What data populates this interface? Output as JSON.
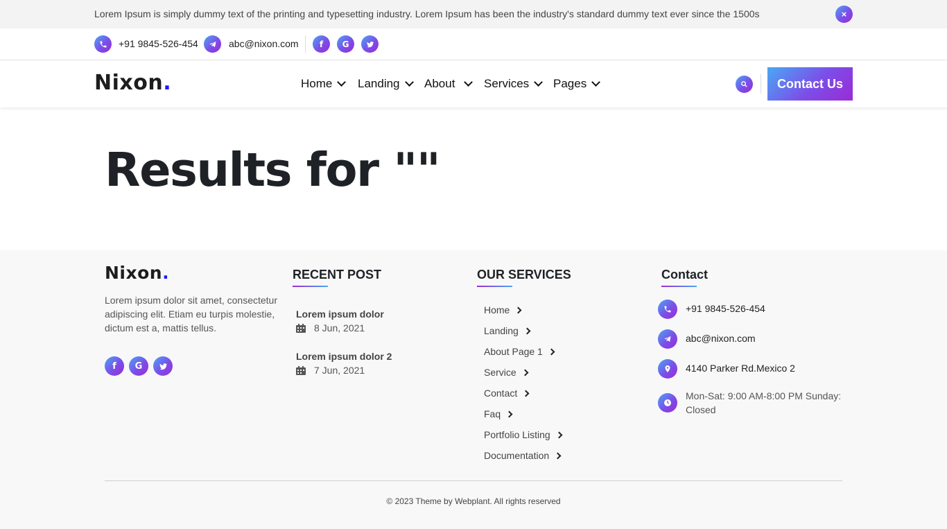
{
  "announcement": {
    "text": "Lorem Ipsum is simply dummy text of the printing and typesetting industry. Lorem Ipsum has been the industry's standard dummy text ever since the 1500s",
    "close_icon": "×"
  },
  "topbar": {
    "phone": "+91 9845-526-454",
    "email": "abc@nixon.com",
    "social": [
      {
        "icon": "facebook-icon",
        "glyph": "f"
      },
      {
        "icon": "google-icon",
        "glyph": "G"
      },
      {
        "icon": "twitter-icon",
        "glyph": "t"
      }
    ]
  },
  "header": {
    "logo": "Nixon",
    "logo_dot": ".",
    "nav": [
      {
        "label": "Home"
      },
      {
        "label": "Landing"
      },
      {
        "label": "About"
      },
      {
        "label": "Services"
      },
      {
        "label": "Pages"
      }
    ],
    "contact_button": "Contact Us"
  },
  "main": {
    "results_title": "Results for \"\""
  },
  "footer": {
    "logo": "Nixon",
    "logo_dot": ".",
    "about": "Lorem ipsum dolor sit amet, consectetur adipiscing elit. Etiam eu turpis molestie, dictum est a, mattis tellus.",
    "social": [
      {
        "icon": "facebook-icon",
        "glyph": "f"
      },
      {
        "icon": "google-icon",
        "glyph": "G"
      },
      {
        "icon": "twitter-icon",
        "glyph": "t"
      }
    ],
    "recent_post": {
      "heading": "RECENT POST",
      "posts": [
        {
          "title": "Lorem ipsum dolor",
          "date": "8 Jun, 2021"
        },
        {
          "title": "Lorem ipsum dolor 2",
          "date": "7 Jun, 2021"
        }
      ]
    },
    "services": {
      "heading": "OUR SERVICES",
      "items": [
        "Home",
        "Landing",
        "About Page 1",
        "Service",
        "Contact",
        "Faq",
        "Portfolio Listing",
        "Documentation"
      ]
    },
    "contact": {
      "heading": "Contact",
      "phone": "+91 9845-526-454",
      "email": "abc@nixon.com",
      "address": "4140 Parker Rd.Mexico 2",
      "hours": "Mon-Sat: 9:00 AM-8:00 PM Sunday: Closed"
    },
    "copyright": "© 2023 Theme by Webplant. All rights reserved"
  },
  "colors": {
    "gradient_start": "#4aa8f5",
    "gradient_mid": "#7b4ee8",
    "gradient_end": "#9b2bd6",
    "logo_dot": "#1a1aff"
  }
}
